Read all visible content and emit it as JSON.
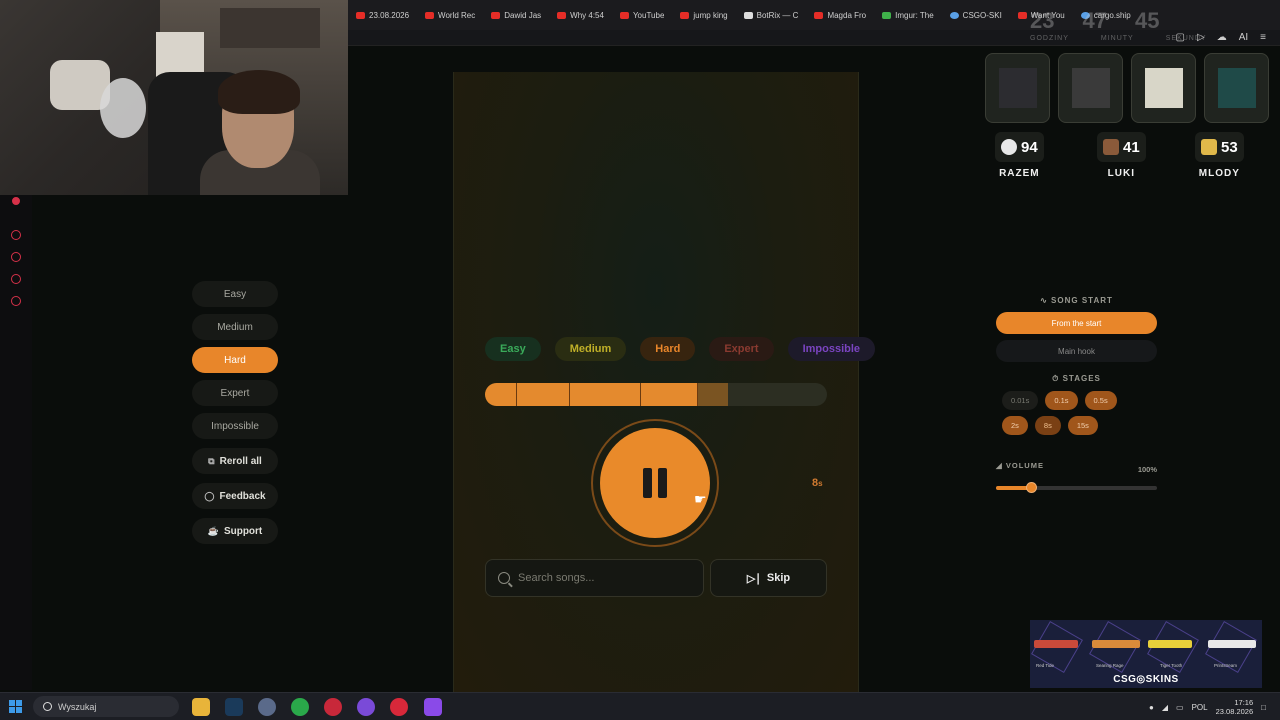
{
  "browser": {
    "tabs": [
      {
        "label": "23.08.2026",
        "icon": "calendar-icon"
      },
      {
        "label": "World Rec",
        "icon": "youtube-icon"
      },
      {
        "label": "Dawid Jas",
        "icon": "youtube-icon"
      },
      {
        "label": "Why 4:54",
        "icon": "youtube-icon"
      },
      {
        "label": "YouTube",
        "icon": "youtube-icon"
      },
      {
        "label": "jump king",
        "icon": "youtube-icon"
      },
      {
        "label": "BotRix — C",
        "icon": "botrix-icon"
      },
      {
        "label": "Magda Fro",
        "icon": "youtube-icon"
      },
      {
        "label": "Imgur: The",
        "icon": "imgur-icon"
      },
      {
        "label": "CSGO-SKI",
        "icon": "csgo-icon"
      },
      {
        "label": "Want You",
        "icon": "youtube-icon"
      },
      {
        "label": "cargo.ship",
        "icon": "google-icon"
      }
    ],
    "toolbar_ai": "AI"
  },
  "overlay_clock": {
    "hours": "23",
    "minutes": "47",
    "seconds": "45",
    "labels": [
      "GODZINY",
      "MINUTY",
      "SEKUNDY"
    ]
  },
  "scoreboard": {
    "players": [
      {
        "name": "RAZEM",
        "score": "94",
        "icon": "skull-icon",
        "color": "#e8e8e8"
      },
      {
        "name": "LUKI",
        "score": "41",
        "icon": "steve-head-icon",
        "color": "#8a5a3a"
      },
      {
        "name": "MLODY",
        "score": "53",
        "icon": "gold-block-icon",
        "color": "#e0b84a"
      }
    ]
  },
  "left_menu": {
    "difficulties": [
      "Easy",
      "Medium",
      "Hard",
      "Expert",
      "Impossible"
    ],
    "active": "Hard",
    "actions": [
      {
        "label": "Reroll all",
        "icon": "reroll-icon"
      },
      {
        "label": "Feedback",
        "icon": "chat-bubble-icon"
      },
      {
        "label": "Support",
        "icon": "coffee-icon"
      }
    ]
  },
  "game": {
    "difficulty_pills": [
      "Easy",
      "Medium",
      "Hard",
      "Expert",
      "Impossible"
    ],
    "progress_fraction": 0.62,
    "buffered_fraction": 0.71,
    "timer_value": "8",
    "timer_unit": "s",
    "search_placeholder": "Search songs...",
    "skip_label": "Skip"
  },
  "right_panel": {
    "song_start_header": "SONG START",
    "song_start_options": [
      "From the start",
      "Main hook"
    ],
    "song_start_active": "From the start",
    "stages_header": "STAGES",
    "stages": [
      "0.01s",
      "0.1s",
      "0.5s",
      "2s",
      "8s",
      "15s"
    ],
    "volume_header": "VOLUME",
    "volume_value": "100%",
    "volume_fraction": 0.22
  },
  "ad": {
    "brand": "CSG◎SKINS",
    "captions": [
      "Red Tide",
      "Searing Rage",
      "Tiger Tooth",
      "Printstream"
    ]
  },
  "taskbar": {
    "search_label": "Wyszukaj",
    "lang": "POL",
    "time": "17:16",
    "date": "23.08.2026"
  },
  "colors": {
    "accent": "#e8862a",
    "easy": "#3aaa5a",
    "medium": "#c0b028",
    "expert": "#8a3a30",
    "impossible": "#7a44c0"
  }
}
